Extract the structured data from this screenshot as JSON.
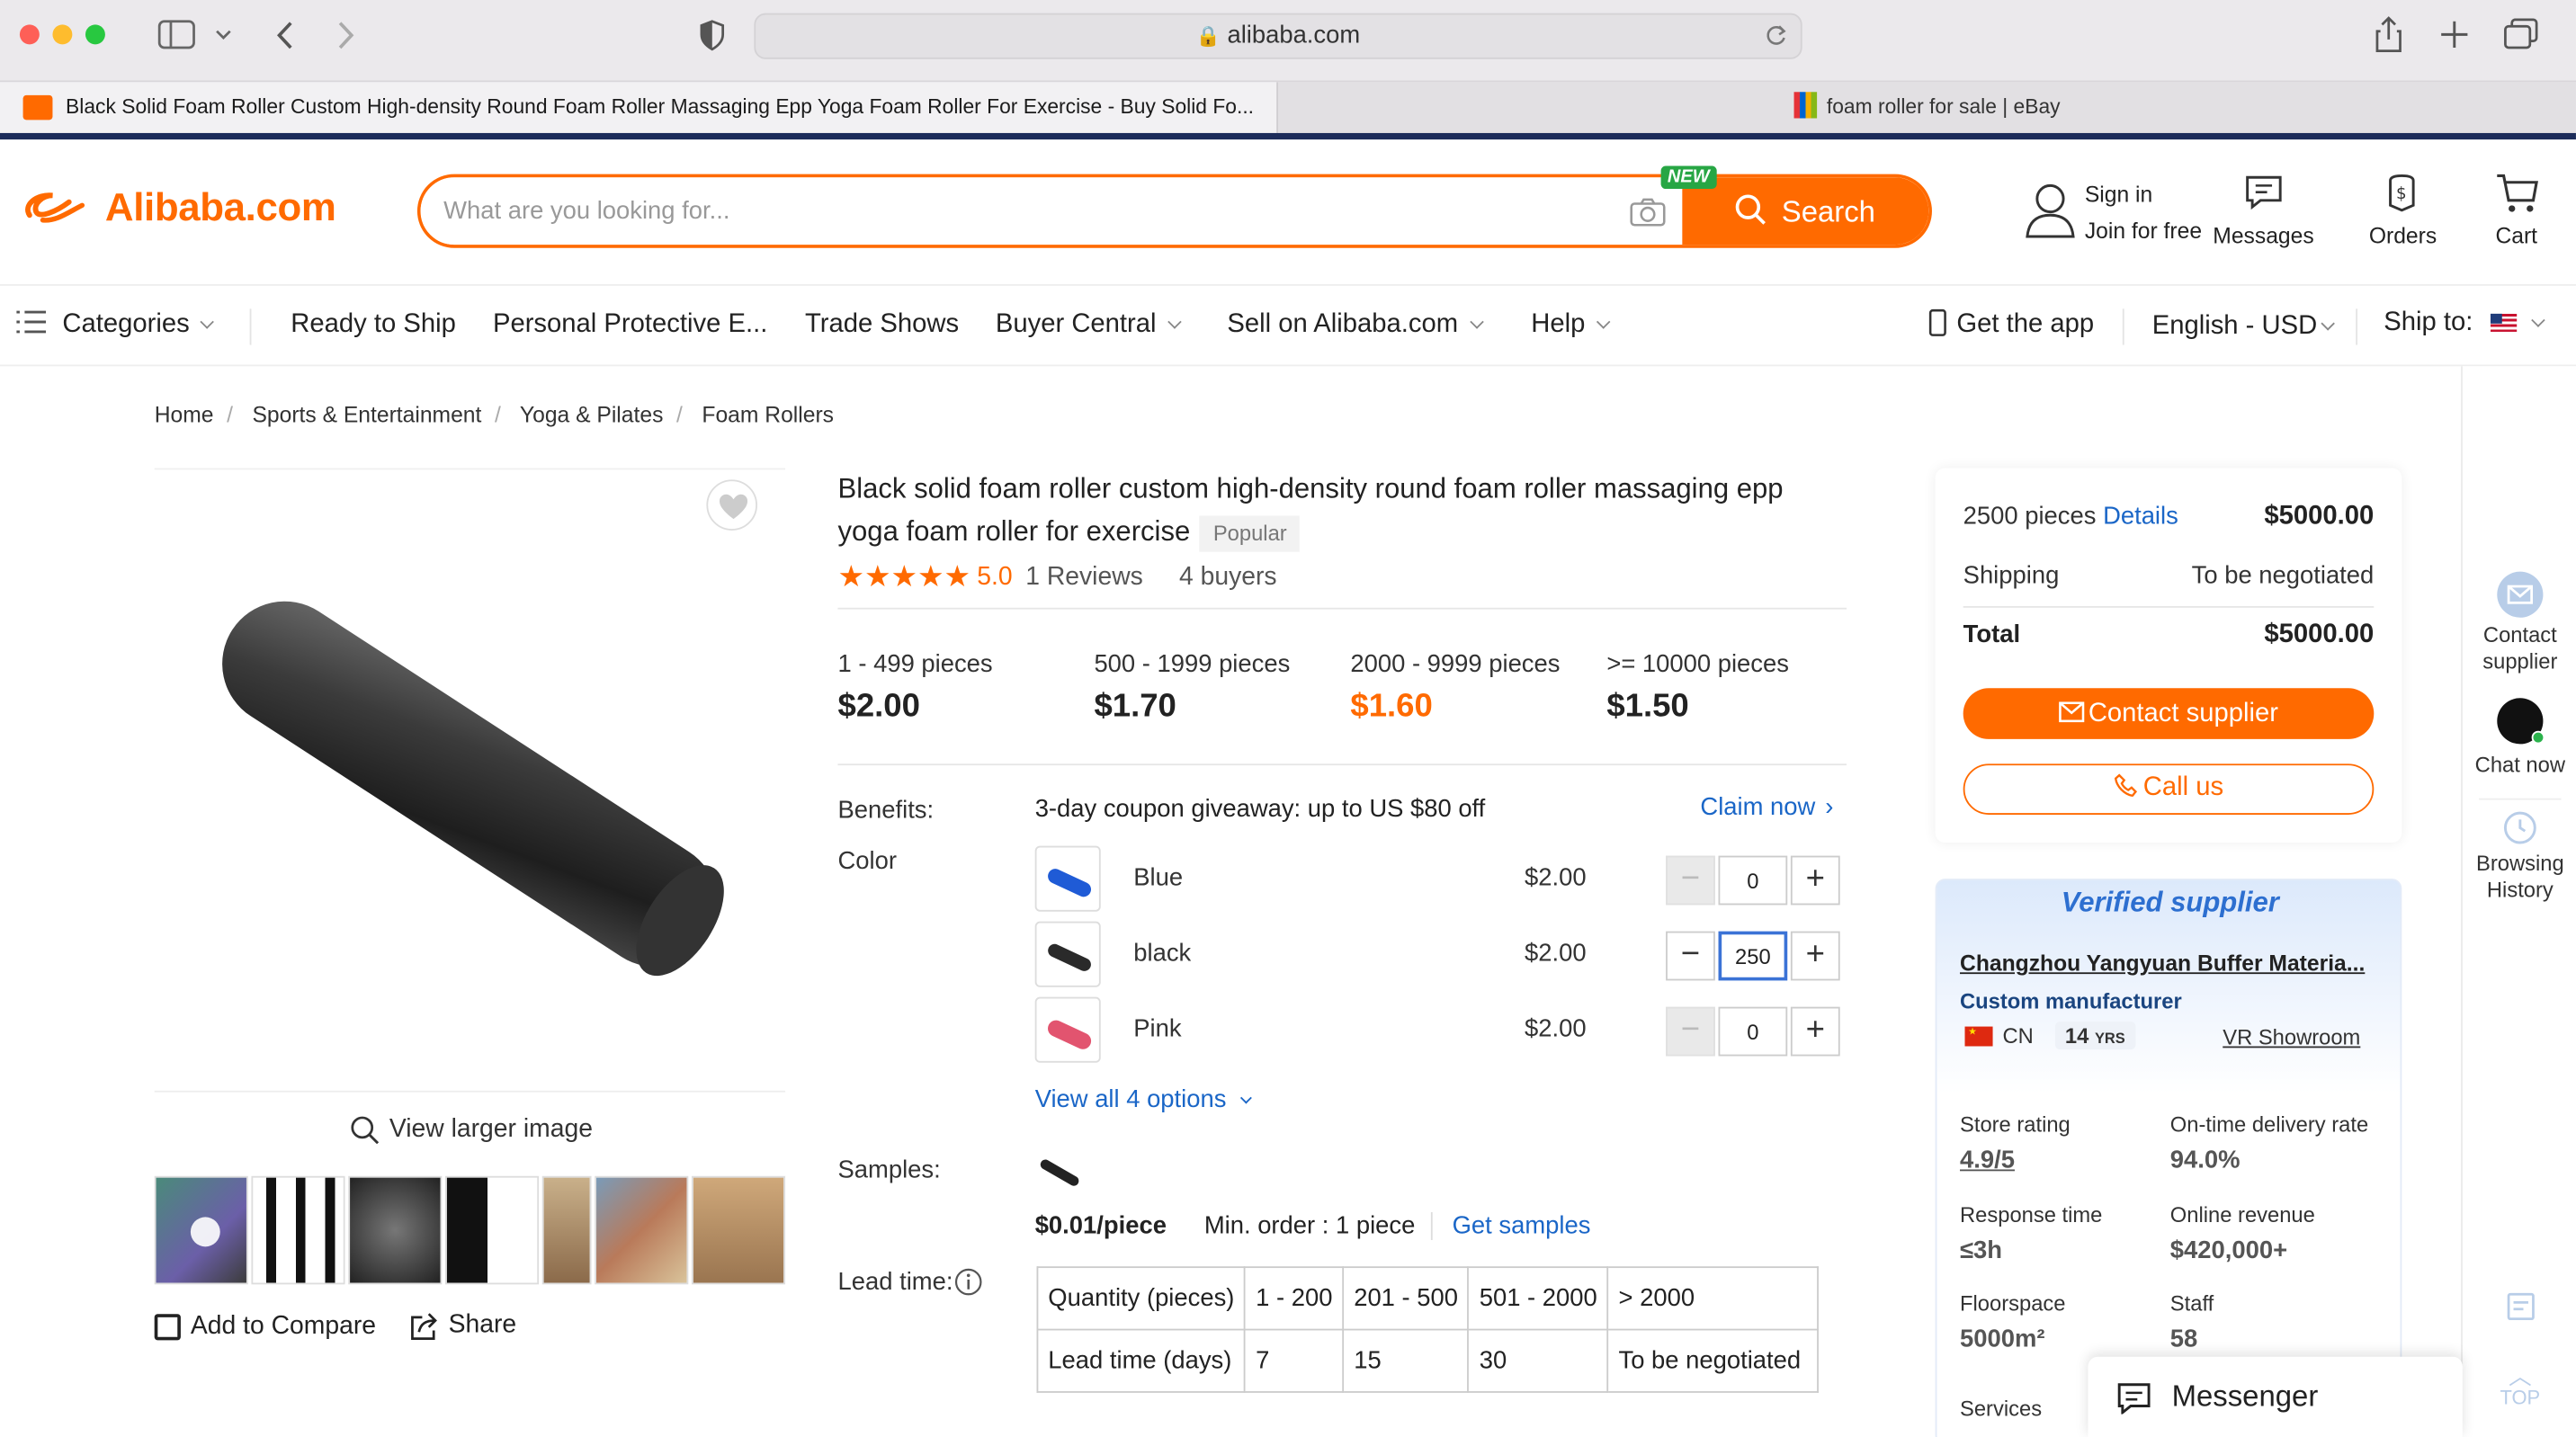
{
  "browser": {
    "url": "alibaba.com",
    "tabs": [
      {
        "title": "Black Solid Foam Roller Custom High-density Round Foam Roller Massaging Epp Yoga Foam Roller For Exercise - Buy Solid Fo..."
      },
      {
        "title": "foam roller for sale | eBay"
      }
    ]
  },
  "header": {
    "logo": "Alibaba.com",
    "search_placeholder": "What are you looking for...",
    "new_badge": "NEW",
    "search_button": "Search",
    "sign_in": "Sign in",
    "join": "Join for free",
    "messages": "Messages",
    "orders": "Orders",
    "cart": "Cart"
  },
  "nav": {
    "categories": "Categories",
    "items": [
      "Ready to Ship",
      "Personal Protective E...",
      "Trade Shows",
      "Buyer Central",
      "Sell on Alibaba.com",
      "Help"
    ],
    "get_app": "Get the app",
    "language": "English - USD",
    "ship_to": "Ship to:"
  },
  "breadcrumb": [
    "Home",
    "Sports & Entertainment",
    "Yoga & Pilates",
    "Foam Rollers"
  ],
  "gallery": {
    "view_larger": "View larger image",
    "add_to_compare": "Add to Compare",
    "share": "Share"
  },
  "product": {
    "title": "Black solid foam roller custom high-density round foam roller massaging epp yoga foam roller for exercise",
    "badge": "Popular",
    "rating": "5.0",
    "reviews": "1 Reviews",
    "buyers": "4 buyers",
    "tiers": [
      {
        "qty": "1 - 499 pieces",
        "price": "$2.00"
      },
      {
        "qty": "500 - 1999 pieces",
        "price": "$1.70"
      },
      {
        "qty": "2000 - 9999 pieces",
        "price": "$1.60"
      },
      {
        "qty": ">= 10000 pieces",
        "price": "$1.50"
      }
    ],
    "benefits_label": "Benefits:",
    "benefits_text": "3-day coupon giveaway: up to US $80 off",
    "claim_now": "Claim now",
    "color_label": "Color",
    "variants": [
      {
        "name": "Blue",
        "price": "$2.00",
        "qty": "0",
        "color": "#1f5bd6"
      },
      {
        "name": "black",
        "price": "$2.00",
        "qty": "250",
        "color": "#2a2a2a"
      },
      {
        "name": "Pink",
        "price": "$2.00",
        "qty": "0",
        "color": "#e2546f"
      }
    ],
    "view_all": "View all 4 options",
    "samples_label": "Samples:",
    "sample_price": "$0.01/piece",
    "min_order": "Min. order : 1 piece",
    "get_samples": "Get samples",
    "lead_label": "Lead time:",
    "lead_table": {
      "header": [
        "Quantity (pieces)",
        "1 - 200",
        "201 - 500",
        "501 - 2000",
        "> 2000"
      ],
      "row": [
        "Lead time (days)",
        "7",
        "15",
        "30",
        "To be negotiated"
      ]
    }
  },
  "summary": {
    "qty_text": "2500 pieces",
    "details": "Details",
    "subtotal": "$5000.00",
    "shipping_label": "Shipping",
    "shipping_value": "To be negotiated",
    "total_label": "Total",
    "total_value": "$5000.00",
    "contact_button": "Contact supplier",
    "call_button": "Call us"
  },
  "supplier": {
    "verified": "Verified supplier",
    "name": "Changzhou Yangyuan Buffer Materia...",
    "type": "Custom manufacturer",
    "country": "CN",
    "years": "14",
    "years_unit": "YRS",
    "vr": "VR Showroom",
    "stats": [
      {
        "label": "Store rating",
        "value": "4.9/5"
      },
      {
        "label": "On-time delivery rate",
        "value": "94.0%"
      },
      {
        "label": "Response time",
        "value": "≤3h"
      },
      {
        "label": "Online revenue",
        "value": "$420,000+"
      },
      {
        "label": "Floorspace",
        "value": "5000m²"
      },
      {
        "label": "Staff",
        "value": "58"
      }
    ],
    "services": "Services"
  },
  "rail": {
    "contact": "Contact supplier",
    "chat": "Chat now",
    "history": "Browsing History",
    "top": "TOP"
  },
  "messenger": "Messenger",
  "colors": {
    "accent": "#ff6a00",
    "link": "#1a66c7"
  }
}
